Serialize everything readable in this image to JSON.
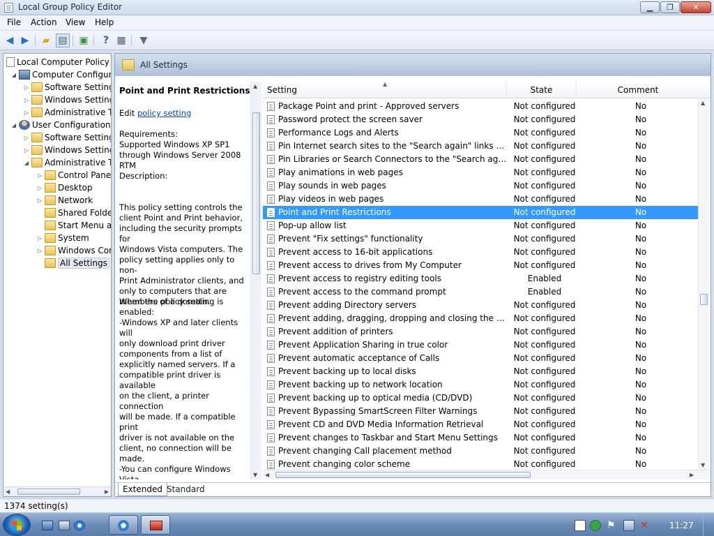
{
  "window": {
    "title": "Local Group Policy Editor"
  },
  "menu": {
    "file": "File",
    "action": "Action",
    "view": "View",
    "help": "Help"
  },
  "tree": {
    "root": "Local Computer Policy",
    "items": [
      {
        "label": "Computer Configura"
      },
      {
        "label": "Software Settings"
      },
      {
        "label": "Windows Setting"
      },
      {
        "label": "Administrative Te"
      },
      {
        "label": "User Configuration"
      },
      {
        "label": "Software Settings"
      },
      {
        "label": "Windows Setting"
      },
      {
        "label": "Administrative Te"
      },
      {
        "label": "Control Panel"
      },
      {
        "label": "Desktop"
      },
      {
        "label": "Network"
      },
      {
        "label": "Shared Folder"
      },
      {
        "label": "Start Menu ar"
      },
      {
        "label": "System"
      },
      {
        "label": "Windows Cor"
      },
      {
        "label": "All Settings"
      }
    ]
  },
  "header": {
    "title": "All Settings"
  },
  "description": {
    "title": "Point and Print Restrictions",
    "edit_prefix": "Edit ",
    "edit_link": "policy setting",
    "requirements": "Requirements:\nSupported Windows XP SP1\nthrough Windows Server 2008 RTM",
    "description_label": "Description:",
    "body1": "This policy setting controls the\nclient Point and Print behavior,\nincluding the security prompts for\nWindows Vista computers. The\npolicy setting applies only to non-\nPrint Administrator clients, and\nonly to computers that are\nmembers of a domain.",
    "body2": "When the policy setting is enabled:\n-Windows XP and later clients will\nonly download print driver\ncomponents from a list of\nexplicitly named servers. If a\ncompatible print driver is available\non the client, a printer connection\nwill be made. If a compatible print\ndriver is not available on the\nclient, no connection will be made.\n-You can configure Windows Vista\nclients so that security warnings\nand elevated command prompts\ndo not appear when users Point\nand Print, or when printer\nconnection drivers need to be\nupdated."
  },
  "list": {
    "columns": {
      "setting": "Setting",
      "state": "State",
      "comment": "Comment"
    },
    "rows": [
      {
        "setting": "Package Point and print - Approved servers",
        "state": "Not configured",
        "comment": "No"
      },
      {
        "setting": "Password protect the screen saver",
        "state": "Not configured",
        "comment": "No"
      },
      {
        "setting": "Performance Logs and Alerts",
        "state": "Not configured",
        "comment": "No"
      },
      {
        "setting": "Pin Internet search sites to the \"Search again\" links and the S...",
        "state": "Not configured",
        "comment": "No"
      },
      {
        "setting": "Pin Libraries or Search Connectors to the \"Search again\" link...",
        "state": "Not configured",
        "comment": "No"
      },
      {
        "setting": "Play animations in web pages",
        "state": "Not configured",
        "comment": "No"
      },
      {
        "setting": "Play sounds in web pages",
        "state": "Not configured",
        "comment": "No"
      },
      {
        "setting": "Play videos in web pages",
        "state": "Not configured",
        "comment": "No"
      },
      {
        "setting": "Point and Print Restrictions",
        "state": "Not configured",
        "comment": "No"
      },
      {
        "setting": "Pop-up allow list",
        "state": "Not configured",
        "comment": "No"
      },
      {
        "setting": "Prevent \"Fix settings\" functionality",
        "state": "Not configured",
        "comment": "No"
      },
      {
        "setting": "Prevent access to 16-bit applications",
        "state": "Not configured",
        "comment": "No"
      },
      {
        "setting": "Prevent access to drives from My Computer",
        "state": "Not configured",
        "comment": "No"
      },
      {
        "setting": "Prevent access to registry editing tools",
        "state": "Enabled",
        "comment": "No"
      },
      {
        "setting": "Prevent access to the command prompt",
        "state": "Enabled",
        "comment": "No"
      },
      {
        "setting": "Prevent adding Directory servers",
        "state": "Not configured",
        "comment": "No"
      },
      {
        "setting": "Prevent adding, dragging, dropping and closing the Taskbar...",
        "state": "Not configured",
        "comment": "No"
      },
      {
        "setting": "Prevent addition of printers",
        "state": "Not configured",
        "comment": "No"
      },
      {
        "setting": "Prevent Application Sharing in true color",
        "state": "Not configured",
        "comment": "No"
      },
      {
        "setting": "Prevent automatic acceptance of Calls",
        "state": "Not configured",
        "comment": "No"
      },
      {
        "setting": "Prevent backing up to local disks",
        "state": "Not configured",
        "comment": "No"
      },
      {
        "setting": "Prevent backing up to network location",
        "state": "Not configured",
        "comment": "No"
      },
      {
        "setting": "Prevent backing up to optical media (CD/DVD)",
        "state": "Not configured",
        "comment": "No"
      },
      {
        "setting": "Prevent Bypassing SmartScreen Filter Warnings",
        "state": "Not configured",
        "comment": "No"
      },
      {
        "setting": "Prevent CD and DVD Media Information Retrieval",
        "state": "Not configured",
        "comment": "No"
      },
      {
        "setting": "Prevent changes to Taskbar and Start Menu Settings",
        "state": "Not configured",
        "comment": "No"
      },
      {
        "setting": "Prevent changing Call placement method",
        "state": "Not configured",
        "comment": "No"
      },
      {
        "setting": "Prevent changing color scheme",
        "state": "Not configured",
        "comment": "No"
      }
    ]
  },
  "tabs": {
    "extended": "Extended",
    "standard": "Standard"
  },
  "status": {
    "count_text": "1374 setting(s)"
  },
  "taskbar": {
    "clock": "11:27"
  },
  "colors": {
    "selection": "#3399ff",
    "link": "#0645ad"
  }
}
